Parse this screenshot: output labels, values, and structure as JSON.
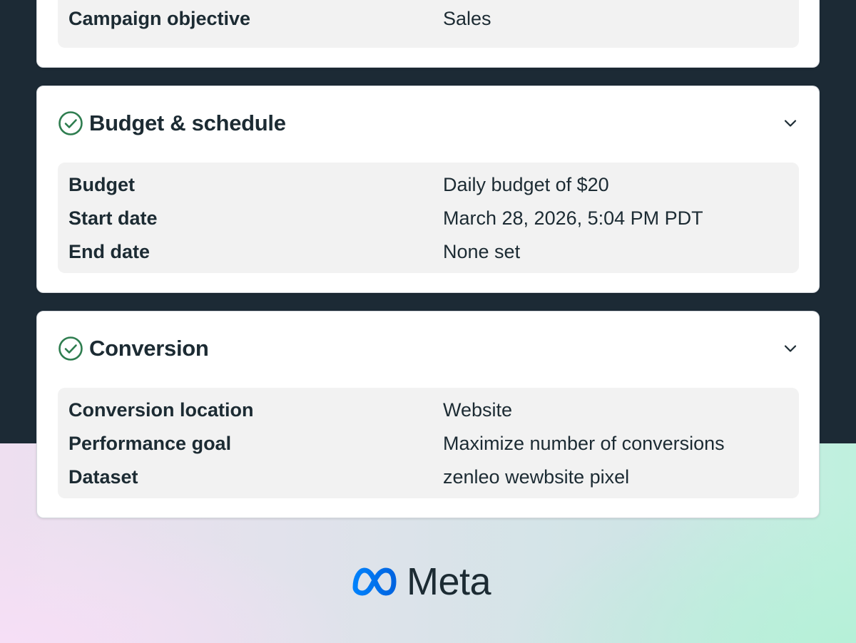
{
  "campaign_card": {
    "rows": [
      {
        "label": "Campaign objective",
        "value": "Sales"
      }
    ]
  },
  "budget_card": {
    "title": "Budget & schedule",
    "rows": [
      {
        "label": "Budget",
        "value": "Daily budget of $20"
      },
      {
        "label": "Start date",
        "value": "March 28, 2026, 5:04 PM PDT"
      },
      {
        "label": "End date",
        "value": "None set"
      }
    ]
  },
  "conversion_card": {
    "title": "Conversion",
    "rows": [
      {
        "label": "Conversion location",
        "value": "Website"
      },
      {
        "label": "Performance goal",
        "value": "Maximize number of conversions"
      },
      {
        "label": "Dataset",
        "value": "zenleo wewbsite pixel"
      }
    ]
  },
  "brand": {
    "name": "Meta",
    "icon": "meta-infinity-icon"
  },
  "colors": {
    "dark_bg": "#1c2a35",
    "check_green": "#2e7d4f",
    "text": "#1c2b33",
    "meta_blue": "#0668e1"
  }
}
